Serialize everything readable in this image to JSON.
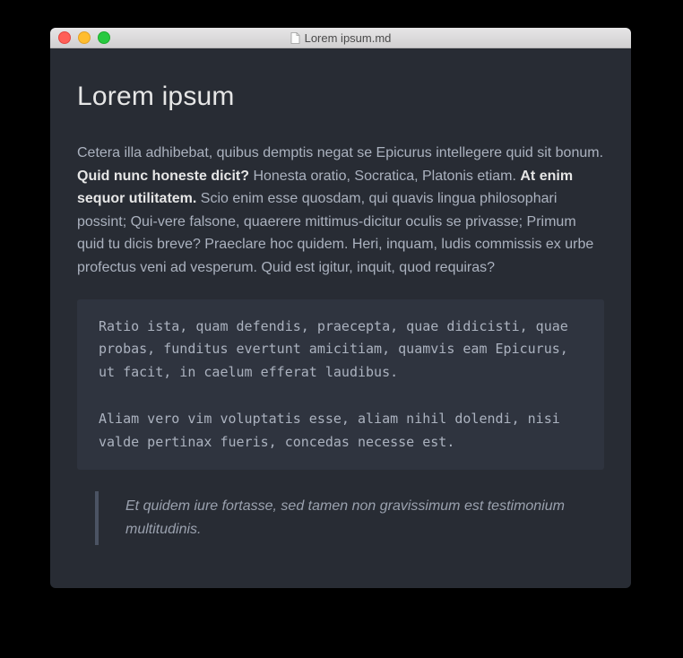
{
  "window": {
    "title": "Lorem ipsum.md"
  },
  "doc": {
    "heading": "Lorem ipsum",
    "para": {
      "seg1": "Cetera illa adhibebat, quibus demptis negat se Epicurus intellegere quid sit bonum. ",
      "bold1": "Quid nunc honeste dicit?",
      "seg2": " Honesta oratio, Socratica, Platonis etiam. ",
      "bold2": "At enim sequor utilitatem.",
      "seg3": " Scio enim esse quosdam, qui quavis lingua philosophari possint; Qui-vere falsone, quaerere mittimus-dicitur oculis se privasse; Primum quid tu dicis breve? Praeclare hoc quidem. Heri, inquam, ludis commissis ex urbe profectus veni ad vesperum. Quid est igitur, inquit, quod requiras?"
    },
    "code": "Ratio ista, quam defendis, praecepta, quae didicisti, quae\nprobas, funditus evertunt amicitiam, quamvis eam Epicurus,\nut facit, in caelum efferat laudibus.\n\nAliam vero vim voluptatis esse, aliam nihil dolendi, nisi\nvalde pertinax fueris, concedas necesse est.",
    "quote": "Et quidem iure fortasse, sed tamen non gravissimum est testimonium multitudinis."
  }
}
